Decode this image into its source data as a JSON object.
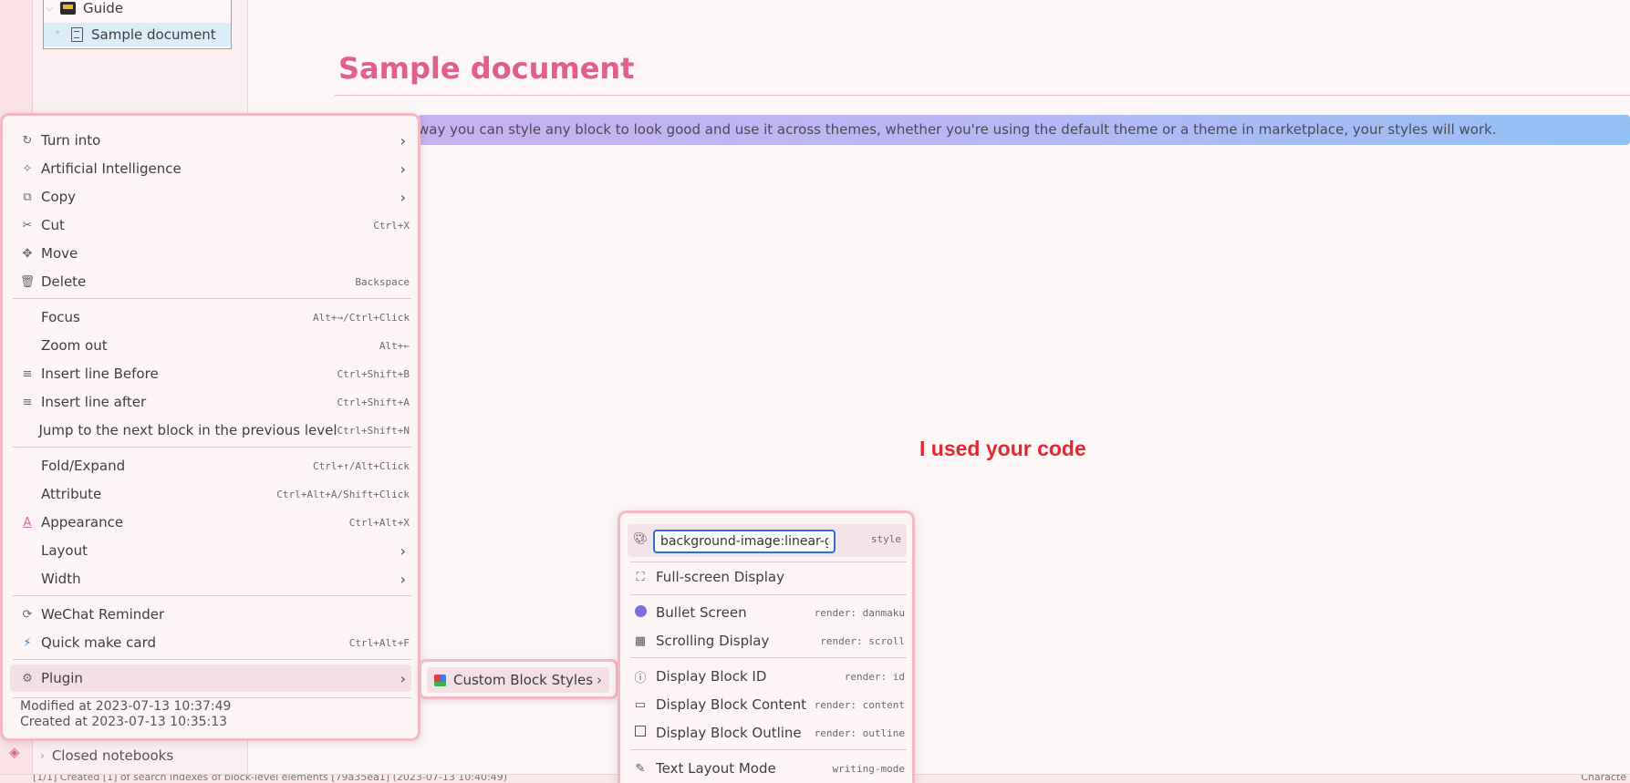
{
  "sidebar": {
    "tree": [
      {
        "label": "Guide",
        "icon": "notebook-icon"
      },
      {
        "label": "Sample document",
        "icon": "document-icon"
      }
    ],
    "closed_notebooks": "Closed notebooks"
  },
  "editor": {
    "title": "Sample document",
    "styled_block_text": "way you can style any block to look good and use it across themes, whether you're using the default theme or a theme in marketplace, your styles will work.",
    "red_text": "I used your code"
  },
  "statusbar": {
    "message": "[1/1] Created [1] of search indexes of block-level elements [79a35ea1] (2023-07-13 10:40:49)",
    "right": "Characte"
  },
  "context_menu": {
    "items": [
      {
        "label": "Turn into",
        "icon": "↻",
        "shortcut": "",
        "submenu": true
      },
      {
        "label": "Artificial Intelligence",
        "icon": "✧",
        "shortcut": "",
        "submenu": true
      },
      {
        "label": "Copy",
        "icon": "⧉",
        "shortcut": "",
        "submenu": true
      },
      {
        "label": "Cut",
        "icon": "✂",
        "shortcut": "Ctrl+X",
        "submenu": false
      },
      {
        "label": "Move",
        "icon": "✥",
        "shortcut": "",
        "submenu": false
      },
      {
        "label": "Delete",
        "icon": "🗑",
        "shortcut": "Backspace",
        "submenu": false
      },
      {
        "label": "Focus",
        "icon": "",
        "shortcut": "Alt+→/Ctrl+Click",
        "submenu": false
      },
      {
        "label": "Zoom out",
        "icon": "",
        "shortcut": "Alt+←",
        "submenu": false
      },
      {
        "label": "Insert line Before",
        "icon": "≡",
        "shortcut": "Ctrl+Shift+B",
        "submenu": false
      },
      {
        "label": "Insert line after",
        "icon": "≡",
        "shortcut": "Ctrl+Shift+A",
        "submenu": false
      },
      {
        "label": "Jump to the next block in the previous level",
        "icon": "",
        "shortcut": "Ctrl+Shift+N",
        "submenu": false
      },
      {
        "label": "Fold/Expand",
        "icon": "",
        "shortcut": "Ctrl+↑/Alt+Click",
        "submenu": false
      },
      {
        "label": "Attribute",
        "icon": "",
        "shortcut": "Ctrl+Alt+A/Shift+Click",
        "submenu": false
      },
      {
        "label": "Appearance",
        "icon": "A",
        "shortcut": "Ctrl+Alt+X",
        "submenu": false
      },
      {
        "label": "Layout",
        "icon": "",
        "shortcut": "",
        "submenu": true
      },
      {
        "label": "Width",
        "icon": "",
        "shortcut": "",
        "submenu": true
      },
      {
        "label": "WeChat Reminder",
        "icon": "⟳",
        "shortcut": "",
        "submenu": false
      },
      {
        "label": "Quick make card",
        "icon": "⚡",
        "shortcut": "Ctrl+Alt+F",
        "submenu": false
      },
      {
        "label": "Plugin",
        "icon": "⚙",
        "shortcut": "",
        "submenu": true
      }
    ],
    "modified": "Modified at 2023-07-13 10:37:49",
    "created": "Created at 2023-07-13 10:35:13"
  },
  "plugin_submenu": {
    "label": "Custom Block Styles"
  },
  "style_submenu": {
    "input_value": "background-image:linear-gradient",
    "input_tag": "style",
    "items": [
      {
        "label": "Full-screen Display",
        "tag": "",
        "icon": "⛶"
      },
      {
        "label": "Bullet Screen",
        "tag": "render: danmaku",
        "icon": "bullet"
      },
      {
        "label": "Scrolling Display",
        "tag": "render: scroll",
        "icon": "▦"
      },
      {
        "label": "Display Block ID",
        "tag": "render: id",
        "icon": "ⓘ"
      },
      {
        "label": "Display Block Content",
        "tag": "render: content",
        "icon": "▭"
      },
      {
        "label": "Display Block Outline",
        "tag": "render: outline",
        "icon": "square"
      },
      {
        "label": "Text Layout Mode",
        "tag": "writing-mode",
        "icon": "✎"
      }
    ]
  },
  "colors": {
    "accent": "#e0608a",
    "menu_border": "#f4b8c4",
    "red_text": "#e5262f",
    "input_focus": "#2f6fd6"
  }
}
